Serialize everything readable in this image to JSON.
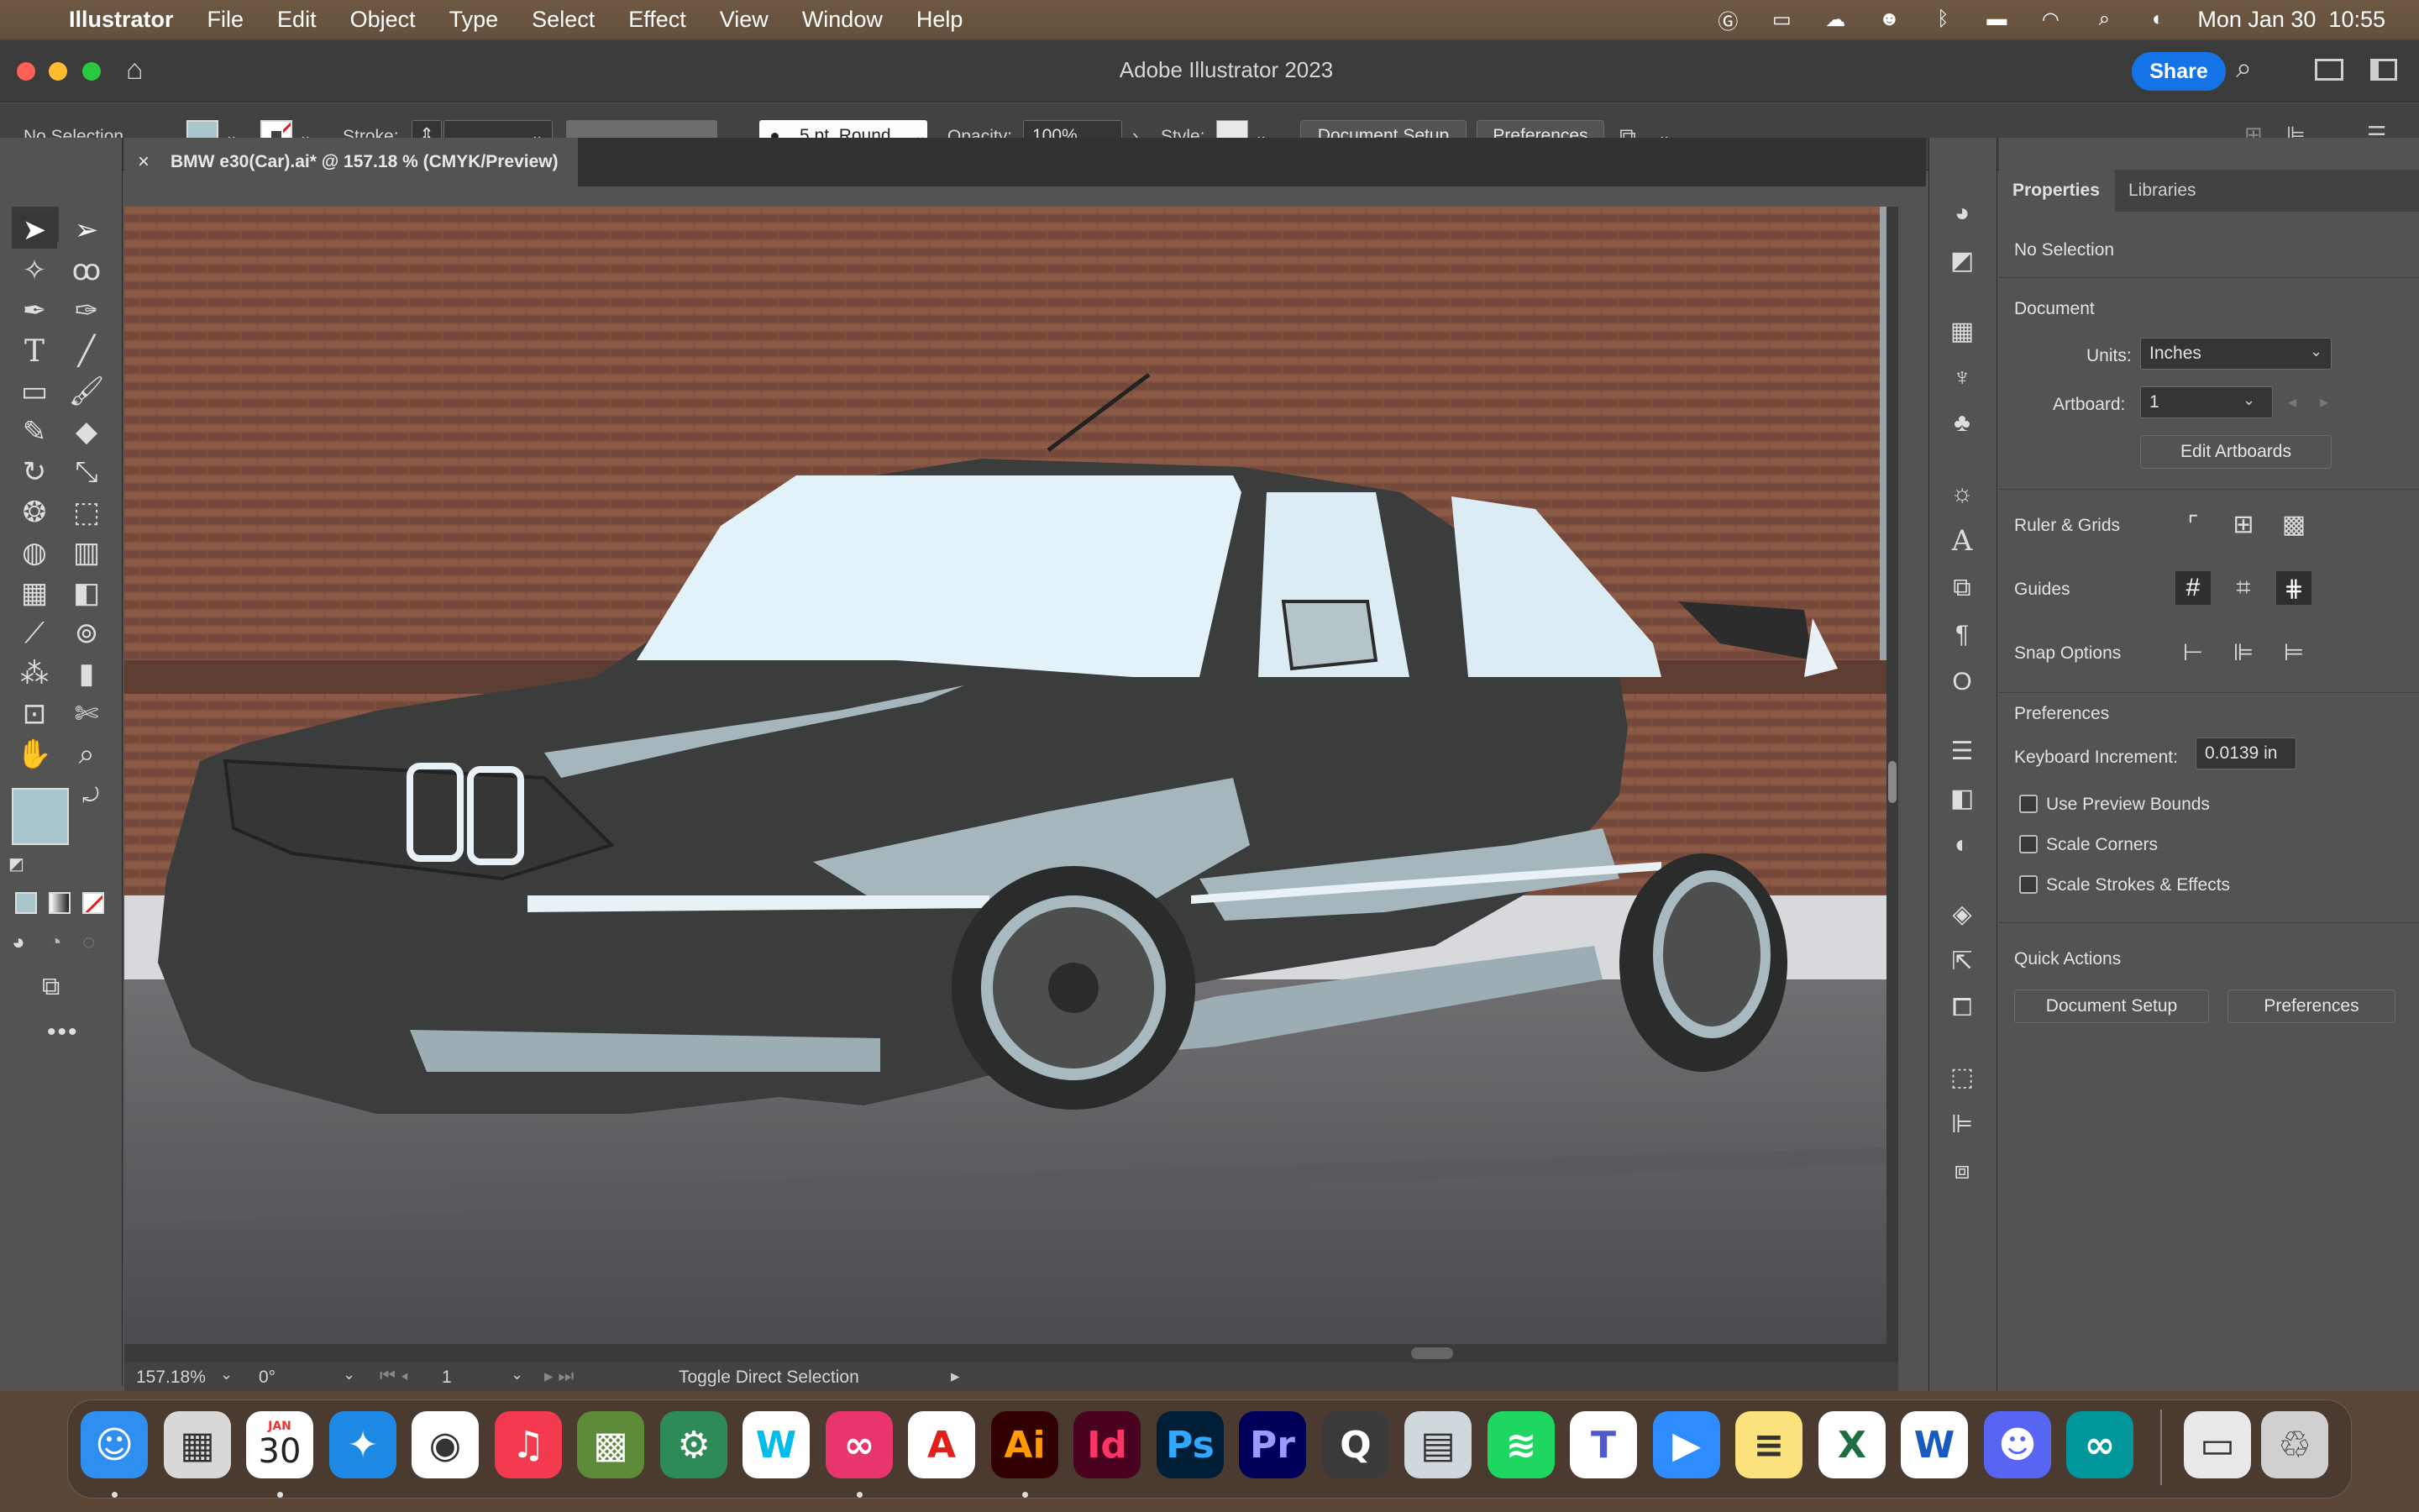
{
  "menubar": {
    "app_name": "Illustrator",
    "menus": [
      "File",
      "Edit",
      "Object",
      "Type",
      "Select",
      "Effect",
      "View",
      "Window",
      "Help"
    ],
    "datetime": "Mon Jan 30  10:55"
  },
  "window": {
    "title": "Adobe Illustrator 2023",
    "share_label": "Share"
  },
  "control_bar": {
    "selection_label": "No Selection",
    "stroke_label": "Stroke:",
    "brush_label": "5 pt. Round",
    "opacity_label": "Opacity:",
    "opacity_value": "100%",
    "style_label": "Style:",
    "document_setup_label": "Document Setup",
    "preferences_label": "Preferences"
  },
  "document_tab": {
    "title": "BMW e30(Car).ai* @ 157.18 % (CMYK/Preview)"
  },
  "status_bar": {
    "zoom": "157.18%",
    "rotation": "0°",
    "artboard": "1",
    "status_text": "Toggle Direct Selection"
  },
  "properties_panel": {
    "tabs": [
      "Properties",
      "Libraries"
    ],
    "selection_label": "No Selection",
    "document_heading": "Document",
    "units_label": "Units:",
    "units_value": "Inches",
    "artboard_label": "Artboard:",
    "artboard_value": "1",
    "edit_artboards_label": "Edit Artboards",
    "ruler_grids_label": "Ruler & Grids",
    "guides_label": "Guides",
    "snap_options_label": "Snap Options",
    "preferences_heading": "Preferences",
    "keyboard_increment_label": "Keyboard Increment:",
    "keyboard_increment_value": "0.0139 in",
    "checkboxes": [
      "Use Preview Bounds",
      "Scale Corners",
      "Scale Strokes & Effects"
    ],
    "quick_actions_heading": "Quick Actions",
    "document_setup_label": "Document Setup",
    "preferences_label": "Preferences"
  },
  "dock": {
    "calendar_month": "JAN",
    "calendar_day": "30",
    "apps": [
      {
        "name": "Finder",
        "glyph": "☺",
        "color": "#2f8ff0"
      },
      {
        "name": "Launchpad",
        "glyph": "▦",
        "color": "#d8d8d8"
      },
      {
        "name": "Calendar",
        "glyph": "",
        "color": "#ffffff"
      },
      {
        "name": "Safari",
        "glyph": "✦",
        "color": "#1e88e5"
      },
      {
        "name": "Chrome",
        "glyph": "◉",
        "color": "#ffffff"
      },
      {
        "name": "Music",
        "glyph": "♫",
        "color": "#f33a4f"
      },
      {
        "name": "Minecraft",
        "glyph": "▩",
        "color": "#5d8b3a"
      },
      {
        "name": "Gear",
        "glyph": "⚙",
        "color": "#2e8b57"
      },
      {
        "name": "Webex",
        "glyph": "W",
        "color": "#ffffff"
      },
      {
        "name": "Creative Cloud",
        "glyph": "∞",
        "color": "#e8356d"
      },
      {
        "name": "Acrobat",
        "glyph": "A",
        "color": "#ffffff"
      },
      {
        "name": "Illustrator",
        "glyph": "Ai",
        "color": "#330000"
      },
      {
        "name": "InDesign",
        "glyph": "Id",
        "color": "#49021f"
      },
      {
        "name": "Photoshop",
        "glyph": "Ps",
        "color": "#001e36"
      },
      {
        "name": "Premiere",
        "glyph": "Pr",
        "color": "#00005b"
      },
      {
        "name": "QuickTime",
        "glyph": "Q",
        "color": "#3a3a3a"
      },
      {
        "name": "Preview",
        "glyph": "▤",
        "color": "#cfd8dc"
      },
      {
        "name": "Spotify",
        "glyph": "≋",
        "color": "#1ed760"
      },
      {
        "name": "Teams",
        "glyph": "T",
        "color": "#ffffff"
      },
      {
        "name": "Zoom",
        "glyph": "▶",
        "color": "#2d8cff"
      },
      {
        "name": "Notes",
        "glyph": "≡",
        "color": "#fce27d"
      },
      {
        "name": "Excel",
        "glyph": "X",
        "color": "#ffffff"
      },
      {
        "name": "Word",
        "glyph": "W",
        "color": "#ffffff"
      },
      {
        "name": "Discord",
        "glyph": "☻",
        "color": "#5865f2"
      },
      {
        "name": "Arduino",
        "glyph": "∞",
        "color": "#00979c"
      },
      {
        "name": "Downloads",
        "glyph": "▭",
        "color": "#e8e8e8"
      },
      {
        "name": "Trash",
        "glyph": "♲",
        "color": "#d0d0d0"
      }
    ]
  },
  "colors": {
    "accent": "#1473e6",
    "fill_swatch": "#a9c6cc",
    "ui_bg": "#535353"
  }
}
